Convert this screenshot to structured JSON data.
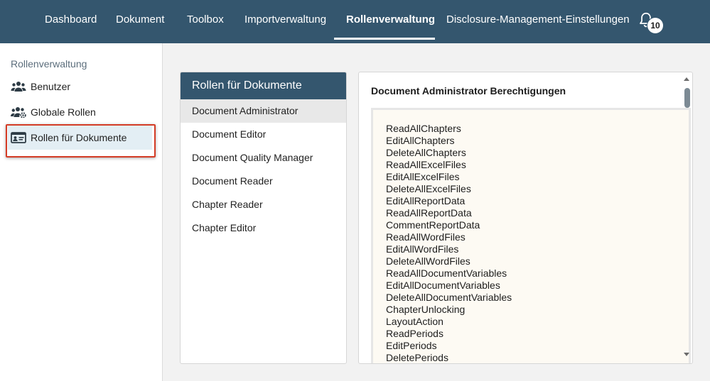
{
  "topnav": {
    "items": [
      {
        "label": "Dashboard"
      },
      {
        "label": "Dokument"
      },
      {
        "label": "Toolbox"
      },
      {
        "label": "Importverwaltung"
      },
      {
        "label": "Rollenverwaltung"
      },
      {
        "label": "Disclosure-Management-Einstellungen"
      }
    ],
    "active_index": 4,
    "notification_count": "10"
  },
  "sidebar": {
    "heading": "Rollenverwaltung",
    "items": [
      {
        "label": "Benutzer",
        "icon": "users-icon"
      },
      {
        "label": "Globale Rollen",
        "icon": "users-gear-icon"
      },
      {
        "label": "Rollen für Dokumente",
        "icon": "id-card-icon"
      }
    ],
    "active_index": 2
  },
  "roles_panel": {
    "title": "Rollen für Dokumente",
    "roles": [
      "Document Administrator",
      "Document Editor",
      "Document Quality Manager",
      "Document Reader",
      "Chapter Reader",
      "Chapter Editor"
    ],
    "selected_index": 0
  },
  "permissions_panel": {
    "title": "Document Administrator Berechtigungen",
    "permissions": [
      "ReadAllChapters",
      "EditAllChapters",
      "DeleteAllChapters",
      "ReadAllExcelFiles",
      "EditAllExcelFiles",
      "DeleteAllExcelFiles",
      "EditAllReportData",
      "ReadAllReportData",
      "CommentReportData",
      "ReadAllWordFiles",
      "EditAllWordFiles",
      "DeleteAllWordFiles",
      "ReadAllDocumentVariables",
      "EditAllDocumentVariables",
      "DeleteAllDocumentVariables",
      "ChapterUnlocking",
      "LayoutAction",
      "ReadPeriods",
      "EditPeriods",
      "DeletePeriods"
    ]
  },
  "colors": {
    "header_bg": "#34566e",
    "highlight_border": "#d43c26",
    "sidebar_active_bg": "#e3eef4",
    "permissions_bg": "#fdfaf3"
  }
}
